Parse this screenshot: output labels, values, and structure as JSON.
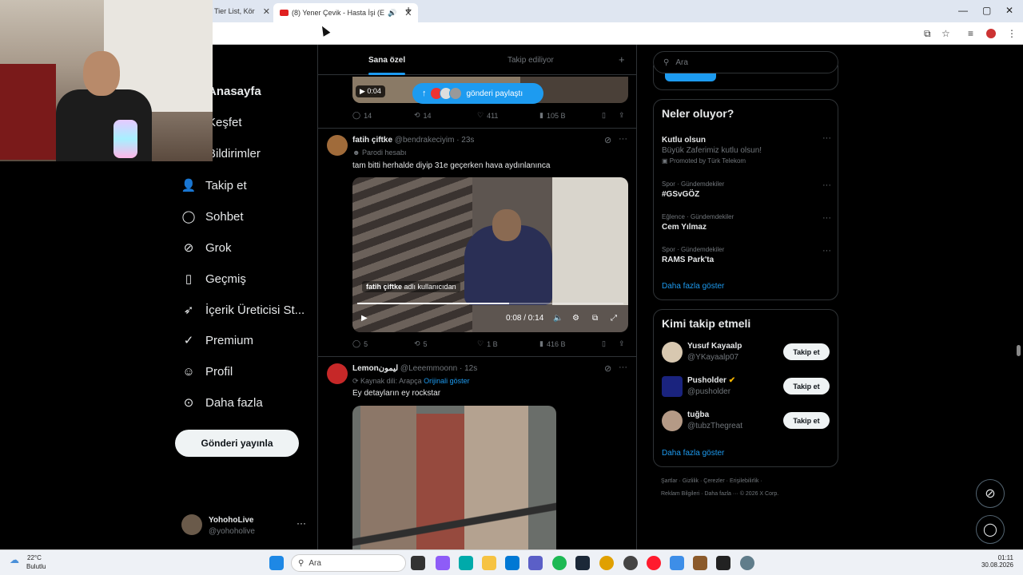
{
  "browser": {
    "tabs": [
      {
        "label": "Tier List, Kör"
      },
      {
        "label": "(8) Yener Çevik - Hasta İşi (E"
      }
    ],
    "new_tab": "+",
    "controls": {
      "minimize": "—",
      "maximize": "▢",
      "close": "✕"
    }
  },
  "nav": {
    "items": [
      {
        "label": "Anasayfa"
      },
      {
        "label": "Keşfet"
      },
      {
        "label": "Bildirimler"
      },
      {
        "label": "Takip et"
      },
      {
        "label": "Sohbet"
      },
      {
        "label": "Grok"
      },
      {
        "label": "Geçmiş"
      },
      {
        "label": "İçerik Üreticisi St..."
      },
      {
        "label": "Premium"
      },
      {
        "label": "Profil"
      },
      {
        "label": "Daha fazla"
      }
    ],
    "post_button": "Gönderi yayınla",
    "profile": {
      "name": "YohohoLive",
      "handle": "@yohoholive",
      "more": "···"
    }
  },
  "feed": {
    "tabs": [
      {
        "label": "Sana özel"
      },
      {
        "label": "Takip ediliyor"
      }
    ],
    "add": "+",
    "share_pill": "gönderi paylaştı",
    "post0": {
      "duration": "0:04",
      "replies": "14",
      "reposts": "14",
      "likes": "411",
      "views": "105 B"
    },
    "post1": {
      "name": "fatih çiftke",
      "handle": "@bendrakeciyim · 23s",
      "sub": "Parodi hesabı",
      "text": "tam bitti herhalde diyip 31e geçerken hava aydınlanınca",
      "attribution_name": "fatih çiftke",
      "attribution_rest": "adlı kullanıcıdan",
      "time": "0:08 / 0:14",
      "progress": 0.57,
      "replies": "5",
      "reposts": "5",
      "likes": "1 B",
      "views": "416 B"
    },
    "post2": {
      "name": "Lemonليمون",
      "handle": "@Leeemmoonn · 12s",
      "sub": "Kaynak dili: Arapça",
      "sub_link": "Orijinali göster",
      "text": "Ey detayların ey rockstar"
    }
  },
  "sidebar": {
    "search_placeholder": "Ara",
    "trends_title": "Neler oluyor?",
    "trends": [
      {
        "category": "",
        "title": "Kutlu olsun",
        "desc": "Büyük Zaferimiz kutlu olsun!",
        "promo": "Promoted by Türk Telekom"
      },
      {
        "category": "Spor · Gündemdekiler",
        "title": "#GSvGÖZ"
      },
      {
        "category": "Eğlence · Gündemdekiler",
        "title": "Cem Yılmaz"
      },
      {
        "category": "Spor · Gündemdekiler",
        "title": "RAMS Park'ta"
      }
    ],
    "show_more": "Daha fazla göster",
    "who_title": "Kimi takip etmeli",
    "who": [
      {
        "name": "Yusuf Kayaalp",
        "handle": "@YKayaalp07",
        "button": "Takip et"
      },
      {
        "name": "Pusholder",
        "handle": "@pusholder",
        "button": "Takip et"
      },
      {
        "name": "tuğba",
        "handle": "@tubzThegreat",
        "button": "Takip et"
      }
    ],
    "footer1": "Şartlar  ·  Gizlilik  ·  Çerezler  ·  Erişilebilirlik  ·",
    "footer2": "Reklam Bilgileri  ·  Daha fazla ···  © 2026 X Corp."
  },
  "taskbar": {
    "temp": "22°C",
    "weather": "Bulutlu",
    "search": "Ara",
    "time": "01:11",
    "date": "30.08.2026"
  }
}
